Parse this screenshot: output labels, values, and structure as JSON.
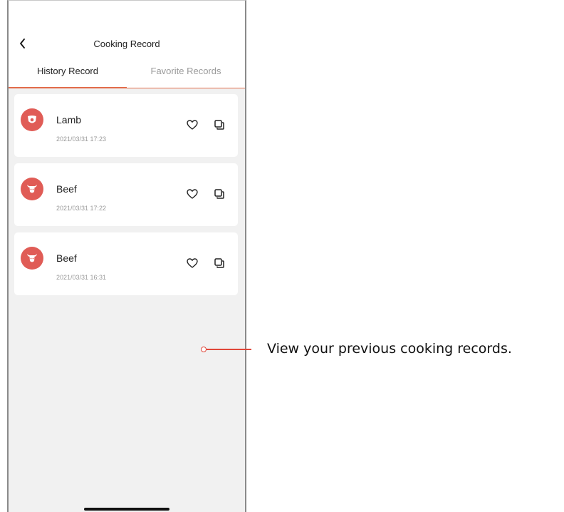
{
  "header": {
    "title": "Cooking Record"
  },
  "tabs": [
    {
      "label": "History Record",
      "active": true
    },
    {
      "label": "Favorite Records",
      "active": false
    }
  ],
  "records": [
    {
      "name": "Lamb",
      "time": "2021/03/31 17:23",
      "icon": "lamb-icon"
    },
    {
      "name": "Beef",
      "time": "2021/03/31 17:22",
      "icon": "beef-icon"
    },
    {
      "name": "Beef",
      "time": "2021/03/31 16:31",
      "icon": "beef-icon"
    }
  ],
  "callout": {
    "text": "View your previous cooking records."
  },
  "colors": {
    "accent": "#e26b4a",
    "avatar": "#e05c56",
    "callout": "#e0473a",
    "list_background": "#f1f1f1"
  }
}
